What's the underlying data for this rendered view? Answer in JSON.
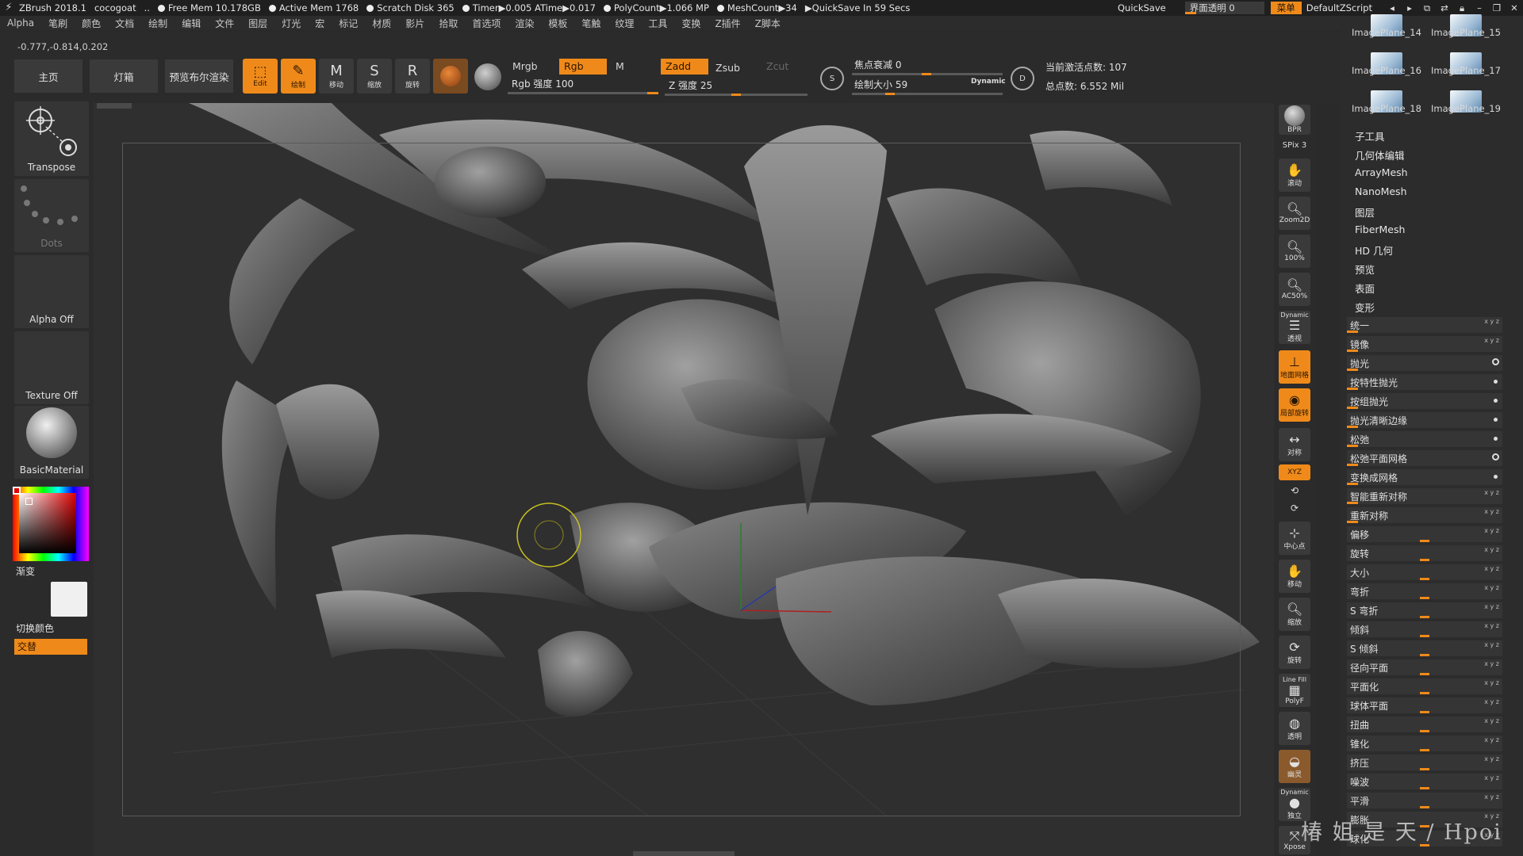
{
  "titlebar": {
    "app": "ZBrush 2018.1",
    "file": "cocogoat",
    "ellipsis": "..",
    "free_mem": "Free Mem 10.178GB",
    "active_mem": "Active Mem 1768",
    "scratch_disk": "Scratch Disk 365",
    "timer": "Timer▶0.005 ATime▶0.017",
    "polycount": "PolyCount▶1.066 MP",
    "meshcount": "MeshCount▶34",
    "quicksave_in": "▶QuickSave In 59 Secs",
    "quicksave": "QuickSave",
    "ui_transparency": "界面透明 0",
    "menu": "菜单",
    "script": "DefaultZScript"
  },
  "menubar": {
    "items": [
      "Alpha",
      "笔刷",
      "颜色",
      "文档",
      "绘制",
      "编辑",
      "文件",
      "图层",
      "灯光",
      "宏",
      "标记",
      "材质",
      "影片",
      "拾取",
      "首选项",
      "渲染",
      "模板",
      "笔触",
      "纹理",
      "工具",
      "变换",
      "Z插件",
      "Z脚本"
    ]
  },
  "coords": "-0.777,-0.814,0.202",
  "toolbar": {
    "home": "主页",
    "lightbox": "灯箱",
    "bpr_preview": "预览布尔渲染",
    "edit": "Edit",
    "draw": "绘制",
    "move": "移动",
    "scale": "缩放",
    "rotate": "旋转",
    "mrgb": "Mrgb",
    "rgb": "Rgb",
    "m": "M",
    "zadd": "Zadd",
    "zsub": "Zsub",
    "zcut": "Zcut",
    "rgb_intensity": "Rgb 强度 100",
    "z_intensity": "Z 强度 25",
    "focal_shift": "焦点衰减 0",
    "draw_size": "绘制大小 59",
    "dynamic": "Dynamic",
    "active_points": "当前激活点数: 107",
    "total_points": "总点数: 6.552 Mil"
  },
  "leftpanel": {
    "brush": "Transpose",
    "stroke": "Dots",
    "alpha": "Alpha Off",
    "texture": "Texture Off",
    "material": "BasicMaterial",
    "gradient": "渐变",
    "switch_color": "切换颜色",
    "alternate": "交替"
  },
  "rshelf": {
    "bpr": "BPR",
    "spix": "SPix 3",
    "scroll": "滚动",
    "zoom2d": "Zoom2D",
    "zoom100": "100%",
    "zoom50": "AC50%",
    "dynamic": "Dynamic",
    "persp": "透视",
    "floor": "地面网格",
    "local": "局部旋转",
    "sym": "对称",
    "xyz": "XYZ",
    "frame": "中心点",
    "move": "移动",
    "scale": "缩放",
    "rotate": "旋转",
    "linefill": "Line Fill",
    "polyf": "PolyF",
    "transp": "透明",
    "ghost": "幽灵",
    "dynamic2": "Dynamic",
    "solo": "独立",
    "xpose": "Xpose"
  },
  "rpanel": {
    "images": [
      "ImagePlane_14",
      "ImagePlane_15",
      "ImagePlane_16",
      "ImagePlane_17",
      "ImagePlane_18",
      "ImagePlane_19"
    ],
    "subtool_menu": [
      "子工具",
      "几何体编辑",
      "ArrayMesh",
      "NanoMesh",
      "图层",
      "FiberMesh",
      "HD 几何",
      "预览",
      "表面",
      "变形"
    ],
    "deformations": [
      "统一",
      "镜像",
      "抛光",
      "按特性抛光",
      "按组抛光",
      "抛光清晰边缘",
      "松弛",
      "松弛平面网格",
      "变换成网格",
      "智能重新对称",
      "重新对称",
      "偏移",
      "旋转",
      "大小",
      "弯折",
      "S 弯折",
      "倾斜",
      "S 倾斜",
      "径向平面",
      "平面化",
      "球体平面",
      "扭曲",
      "锥化",
      "挤压",
      "噪波",
      "平滑",
      "膨胀",
      "球化"
    ],
    "xyz_mark": "x y z"
  },
  "watermark": "椿 姐 是 天 / Hpoi",
  "colors": {
    "accent": "#ef8a1a",
    "panel": "#2b2b2b",
    "viewport": "#2f2f2f"
  }
}
